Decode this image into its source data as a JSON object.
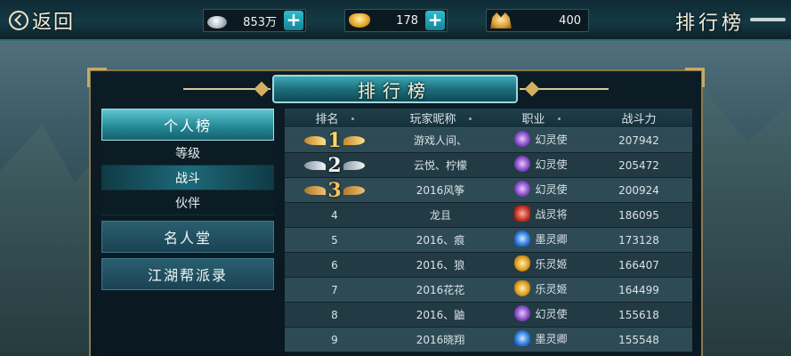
{
  "topbar": {
    "back_label": "返回",
    "resources": [
      {
        "icon": "silver-coin-icon",
        "value": "853万"
      },
      {
        "icon": "gold-ingot-icon",
        "value": "178"
      },
      {
        "icon": "yuanbao-icon",
        "value": "400"
      }
    ],
    "page_title": "排行榜"
  },
  "panel": {
    "title": "排行榜"
  },
  "menu": {
    "categories": [
      {
        "label": "个人榜",
        "active": true
      },
      {
        "label": "名人堂",
        "active": false
      },
      {
        "label": "江湖帮派录",
        "active": false
      }
    ],
    "subitems": [
      {
        "label": "等级",
        "active": false
      },
      {
        "label": "战斗",
        "active": true
      },
      {
        "label": "伙伴",
        "active": false
      }
    ]
  },
  "table": {
    "headers": [
      "排名",
      "玩家昵称",
      "职业",
      "战斗力"
    ],
    "rows": [
      {
        "rank": "1",
        "name": "游戏人间、",
        "job": "幻灵使",
        "job_icon": "huanling-icon",
        "power": "207942"
      },
      {
        "rank": "2",
        "name": "云悦、柠檬",
        "job": "幻灵使",
        "job_icon": "huanling-icon",
        "power": "205472"
      },
      {
        "rank": "3",
        "name": "2016风筝",
        "job": "幻灵使",
        "job_icon": "huanling-icon",
        "power": "200924"
      },
      {
        "rank": "4",
        "name": "龙且",
        "job": "战灵将",
        "job_icon": "zhanling-icon",
        "power": "186095"
      },
      {
        "rank": "5",
        "name": "2016、痕",
        "job": "墨灵卿",
        "job_icon": "moling-icon",
        "power": "173128"
      },
      {
        "rank": "6",
        "name": "2016、狼",
        "job": "乐灵姬",
        "job_icon": "yueling-icon",
        "power": "166407"
      },
      {
        "rank": "7",
        "name": "2016花花",
        "job": "乐灵姬",
        "job_icon": "yueling-icon",
        "power": "164499"
      },
      {
        "rank": "8",
        "name": "2016、鼬",
        "job": "幻灵使",
        "job_icon": "huanling-icon",
        "power": "155618"
      },
      {
        "rank": "9",
        "name": "2016晓翔",
        "job": "墨灵卿",
        "job_icon": "moling-icon",
        "power": "155548"
      }
    ]
  }
}
